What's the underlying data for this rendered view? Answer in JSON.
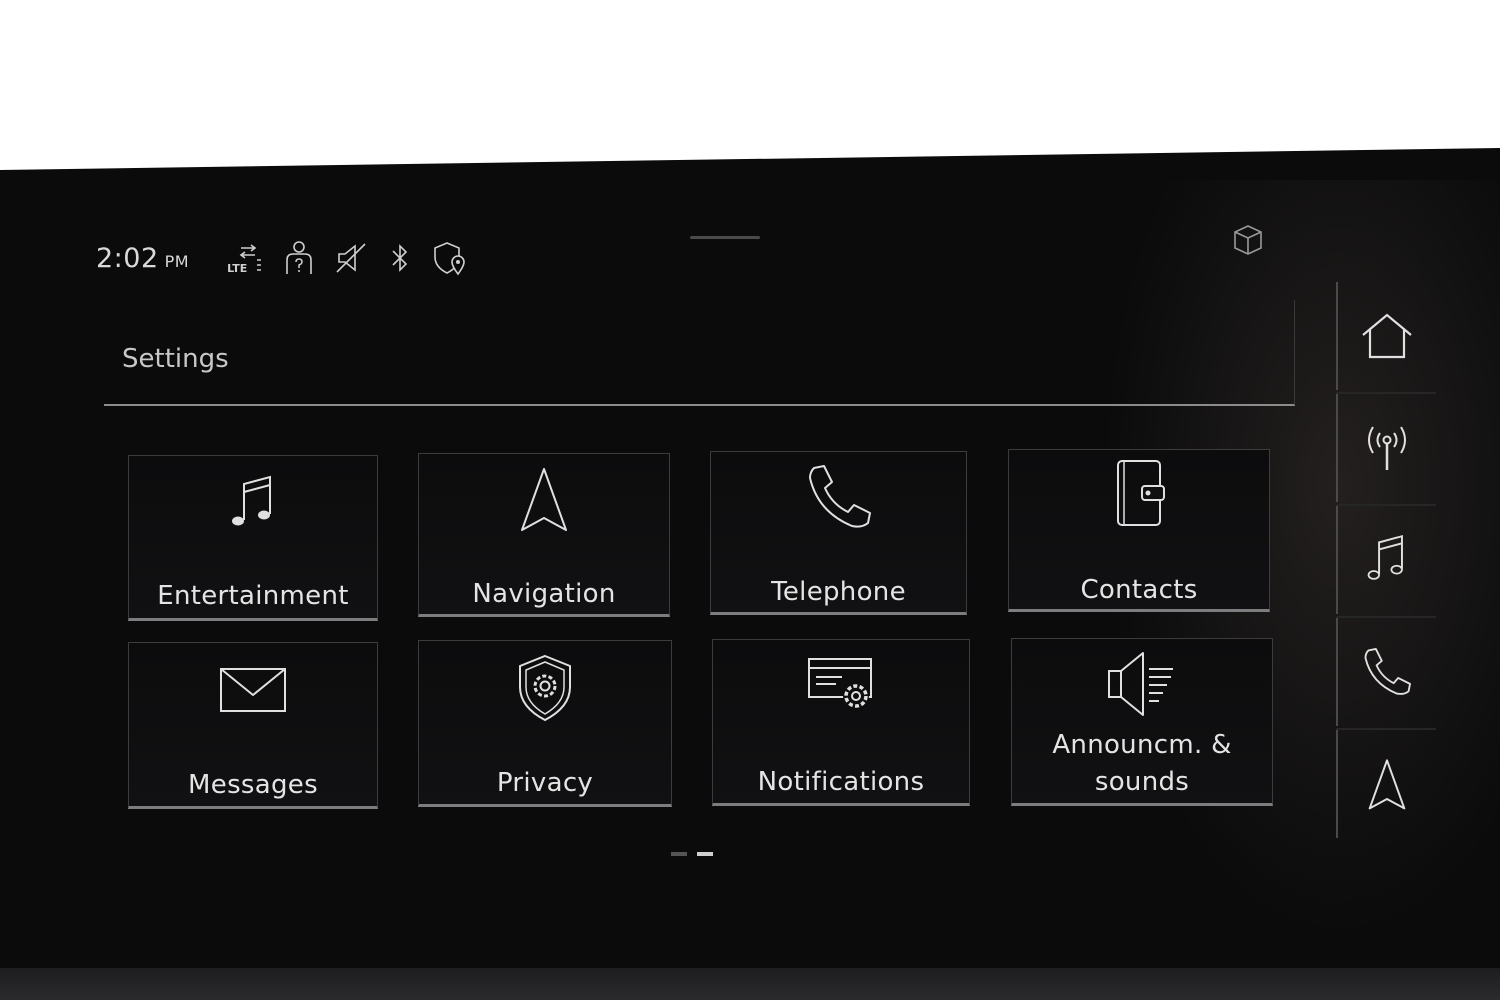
{
  "status_bar": {
    "time": "2:02",
    "ampm": "PM",
    "network_label": "LTE",
    "icons": [
      "lte-data-icon",
      "passenger-help-icon",
      "mute-icon",
      "bluetooth-icon",
      "location-privacy-icon"
    ]
  },
  "header": {
    "title": "Settings",
    "top_right_icon": "3d-cube-icon"
  },
  "tiles": [
    {
      "label": "Entertainment",
      "icon": "music-note-icon"
    },
    {
      "label": "Navigation",
      "icon": "navigation-arrow-icon"
    },
    {
      "label": "Telephone",
      "icon": "phone-icon"
    },
    {
      "label": "Contacts",
      "icon": "contacts-book-icon"
    },
    {
      "label": "Messages",
      "icon": "envelope-icon"
    },
    {
      "label": "Privacy",
      "icon": "shield-gear-icon"
    },
    {
      "label": "Notifications",
      "icon": "notifications-gear-icon"
    },
    {
      "label_line1": "Announcm. &",
      "label_line2": "sounds",
      "icon": "speaker-icon"
    }
  ],
  "pager": {
    "pages": 2,
    "active_page": 2
  },
  "rail": [
    {
      "name": "home",
      "icon": "home-icon"
    },
    {
      "name": "radio",
      "icon": "radio-antenna-icon"
    },
    {
      "name": "media",
      "icon": "music-note-icon"
    },
    {
      "name": "phone",
      "icon": "phone-icon"
    },
    {
      "name": "navigation",
      "icon": "navigation-arrow-icon"
    }
  ],
  "colors": {
    "background": "#0b0b0c",
    "text": "#e4e4e4",
    "tile_border": "#7d7d80"
  }
}
